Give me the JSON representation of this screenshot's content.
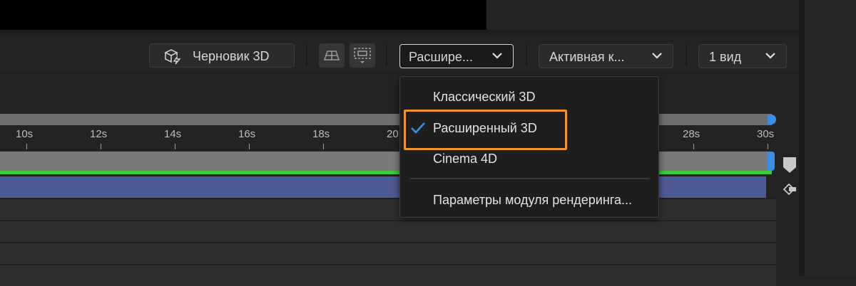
{
  "toolbar": {
    "draft_3d_label": "Черновик 3D",
    "renderer_label": "Расшире...",
    "camera_label": "Активная к...",
    "views_label": "1 вид"
  },
  "renderer_menu": {
    "items": [
      {
        "label": "Классический 3D",
        "checked": false
      },
      {
        "label": "Расширенный 3D",
        "checked": true
      },
      {
        "label": "Cinema 4D",
        "checked": false
      }
    ],
    "settings_label": "Параметры модуля рендеринга..."
  },
  "timeline": {
    "ticks": [
      "10s",
      "12s",
      "14s",
      "16s",
      "18s",
      "20",
      "28s",
      "30s"
    ]
  },
  "colors": {
    "highlight": "#f0932c",
    "check": "#3a8ee6",
    "layer_bar": "#4e5a93",
    "green_line": "#3dcb3d"
  }
}
